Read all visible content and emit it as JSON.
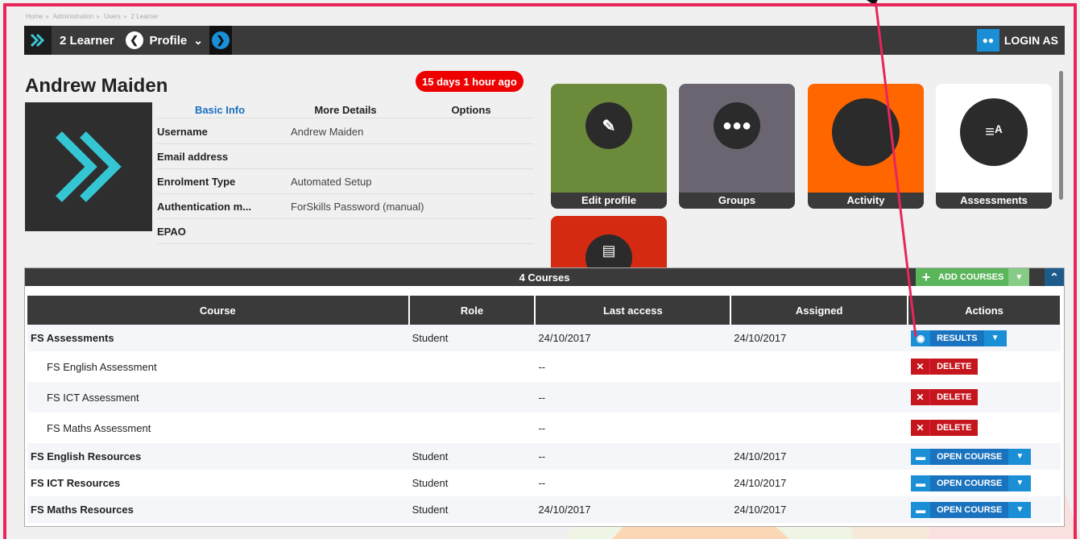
{
  "breadcrumb": [
    "Home",
    "Administration",
    "Users",
    "2 Learner"
  ],
  "topbar": {
    "title": "2 Learner",
    "profile_label": "Profile",
    "login_as": "LOGIN AS"
  },
  "user": {
    "name": "Andrew Maiden",
    "last_seen": "15 days 1 hour ago"
  },
  "tabs": [
    "Basic Info",
    "More Details",
    "Options"
  ],
  "info": [
    {
      "key": "Username",
      "value": "Andrew Maiden"
    },
    {
      "key": "Email address",
      "value": ""
    },
    {
      "key": "Enrolment Type",
      "value": "Automated Setup"
    },
    {
      "key": "Authentication m...",
      "value": "ForSkills Password (manual)"
    },
    {
      "key": "EPAO",
      "value": ""
    }
  ],
  "tiles": [
    {
      "label": "Edit profile",
      "color": "#6b8a3a",
      "icon": "user-edit-icon"
    },
    {
      "label": "Groups",
      "color": "#6a6570",
      "icon": "group-icon"
    },
    {
      "label": "Activity",
      "color": "#ff6600",
      "icon": "activity-icon"
    },
    {
      "label": "Assessments",
      "color": "#ffffff",
      "icon": "assessment-icon"
    }
  ],
  "courses": {
    "header": "4 Courses",
    "add_label": "ADD COURSES",
    "columns": [
      "Course",
      "Role",
      "Last access",
      "Assigned",
      "Actions"
    ],
    "rows": [
      {
        "course": "FS Assessments",
        "role": "Student",
        "last": "24/10/2017",
        "assigned": "24/10/2017",
        "action": "RESULTS"
      },
      {
        "course": "FS English Assessment",
        "role": "",
        "last": "--",
        "assigned": "",
        "action": "DELETE"
      },
      {
        "course": "FS ICT Assessment",
        "role": "",
        "last": "--",
        "assigned": "",
        "action": "DELETE"
      },
      {
        "course": "FS Maths Assessment",
        "role": "",
        "last": "--",
        "assigned": "",
        "action": "DELETE"
      },
      {
        "course": "FS English Resources",
        "role": "Student",
        "last": "--",
        "assigned": "24/10/2017",
        "action": "OPEN COURSE"
      },
      {
        "course": "FS ICT Resources",
        "role": "Student",
        "last": "--",
        "assigned": "24/10/2017",
        "action": "OPEN COURSE"
      },
      {
        "course": "FS Maths Resources",
        "role": "Student",
        "last": "24/10/2017",
        "assigned": "24/10/2017",
        "action": "OPEN COURSE"
      }
    ]
  },
  "colors": {
    "accent_blue": "#1a8fd6",
    "annotation_pink": "#e8265a",
    "badge_red": "#ee0000"
  }
}
